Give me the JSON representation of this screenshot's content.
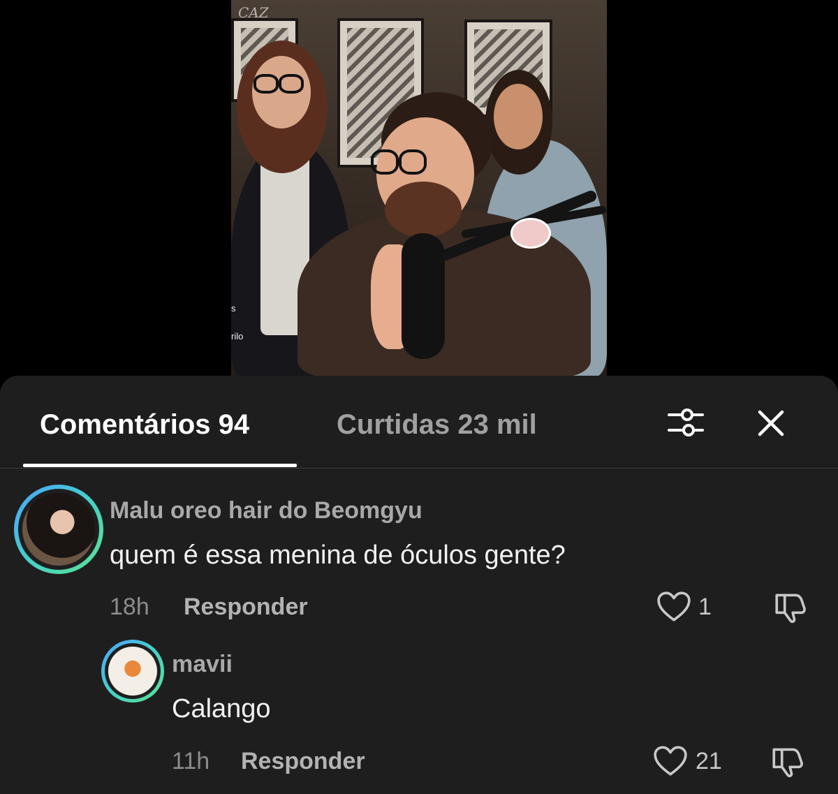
{
  "video": {
    "watermark": "CAZ",
    "side_label_1": "s",
    "side_label_2": "rilo"
  },
  "tabs": {
    "comments_label": "Comentários 94",
    "likes_label": "Curtidas 23 mil"
  },
  "icons": {
    "filter": "sliders-icon",
    "close": "close-icon",
    "like": "heart-outline-icon",
    "dislike": "thumbs-down-outline-icon"
  },
  "colors": {
    "sheet_bg": "#1e1e1e",
    "avatar_ring_start": "#4aa3ff",
    "avatar_ring_end": "#5be38f"
  },
  "comments": [
    {
      "username": "Malu oreo hair do Beomgyu",
      "text": "quem é essa menina de óculos gente?",
      "time": "18h",
      "reply_label": "Responder",
      "likes": "1"
    },
    {
      "username": "mavii",
      "text": "Calango",
      "time": "11h",
      "reply_label": "Responder",
      "likes": "21"
    }
  ]
}
